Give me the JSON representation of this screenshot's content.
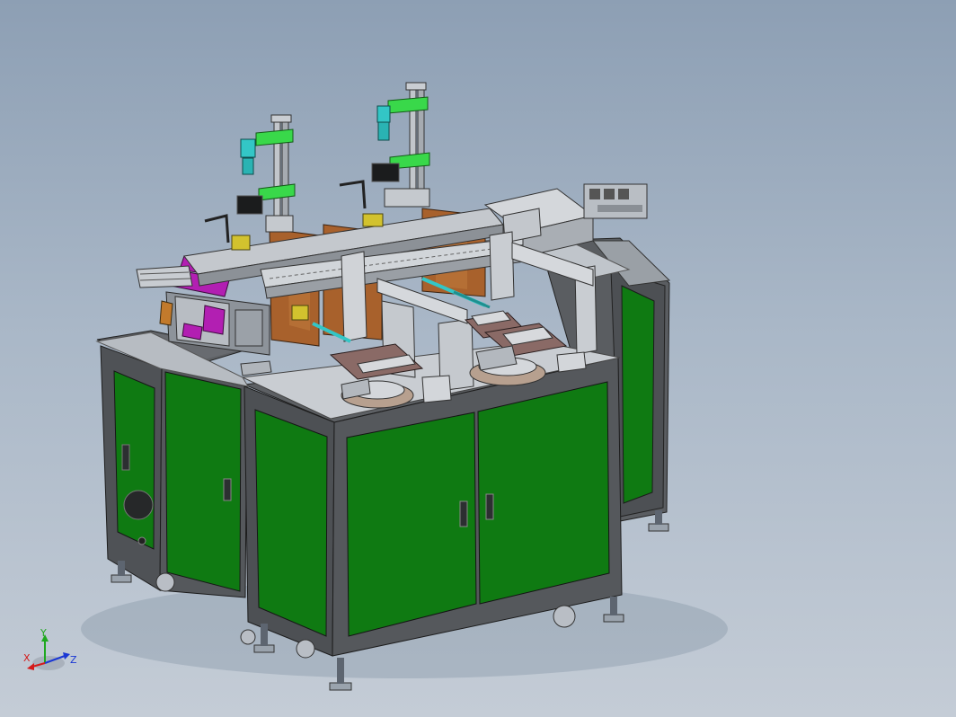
{
  "viewport": {
    "background_top": "#8d9fb4",
    "background_bottom": "#c4ccd6"
  },
  "model": {
    "cabinet_panel_color": "#0f7a12",
    "cabinet_frame_color": "#55585c",
    "tabletop_color": "#c9cdd2",
    "accent_green": "#39d84a",
    "accent_cyan": "#33c6c6",
    "accent_magenta": "#b21fb2",
    "accent_copper": "#a8612c"
  },
  "triad": {
    "x_label": "X",
    "y_label": "Y",
    "z_label": "Z",
    "x_color": "#d41a1a",
    "y_color": "#1fa81f",
    "z_color": "#1a37d4"
  }
}
